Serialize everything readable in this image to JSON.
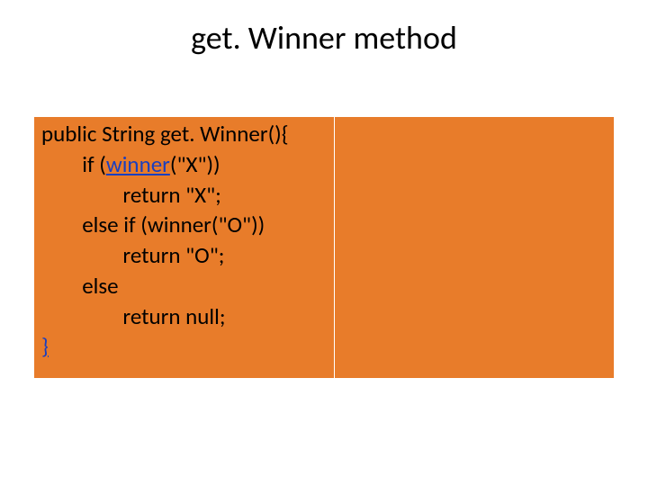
{
  "title": "get. Winner method",
  "code": {
    "l1a": "public String get. Winner(){",
    "l2a": "        if (",
    "l2b": "winner",
    "l2c": "(\"X\"))",
    "l3": "                return \"X\";",
    "l4": "        else if (winner(\"O\"))",
    "l5": "                return \"O\";",
    "l6": "        else",
    "l7": "                return null;",
    "l8": "}"
  }
}
